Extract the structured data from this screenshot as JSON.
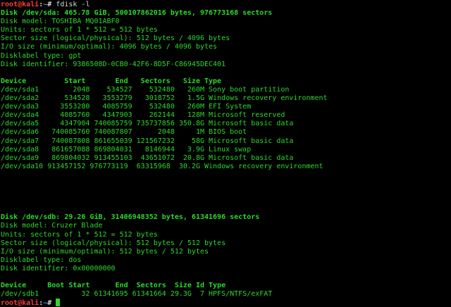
{
  "colors": {
    "text": "#2bd92b",
    "prompt_user": "#ff3b3b",
    "prompt_path": "#4a8cff",
    "background": "#000000"
  },
  "prompt": {
    "user": "root@kali",
    "sep": ":",
    "path": "~",
    "symbol": "# ",
    "command": "fdisk -l"
  },
  "disk1": {
    "header": "Disk /dev/sda: 465.78 GiB, 500107862016 bytes, 976773168 sectors",
    "info": [
      "Disk model: TOSHIBA MQ01ABF0",
      "Units: sectors of 1 * 512 = 512 bytes",
      "Sector size (logical/physical): 512 bytes / 4096 bytes",
      "I/O size (minimum/optimal): 4096 bytes / 4096 bytes",
      "Disklabel type: gpt",
      "Disk identifier: 9386508D-0CB0-42F6-8D5F-C86945DEC401"
    ],
    "table_header": "Device         Start       End   Sectors   Size Type",
    "rows": [
      "/dev/sda1        2048    534527    532480   260M Sony boot partition",
      "/dev/sda2      534528   3553279   3018752   1.5G Windows recovery environment",
      "/dev/sda3     3553280   4085759    532480   260M EFI System",
      "/dev/sda4     4085760   4347903    262144   128M Microsoft reserved",
      "/dev/sda5     4347904 740085759 735737856 350.8G Microsoft basic data",
      "/dev/sda6   740085760 740087807      2048     1M BIOS boot",
      "/dev/sda7   740087808 861655039 121567232    58G Microsoft basic data",
      "/dev/sda8   861657088 869804031   8146944   3.9G Linux swap",
      "/dev/sda9   869804032 913455103  43651072  20.8G Microsoft basic data",
      "/dev/sda10 913457152 976773119  63315968  30.2G Windows recovery environment"
    ]
  },
  "disk2": {
    "header": "Disk /dev/sdb: 29.26 GiB, 31406948352 bytes, 61341696 sectors",
    "info": [
      "Disk model: Cruzer Blade",
      "Units: sectors of 1 * 512 = 512 bytes",
      "Sector size (logical/physical): 512 bytes / 512 bytes",
      "I/O size (minimum/optimal): 512 bytes / 512 bytes",
      "Disklabel type: dos",
      "Disk identifier: 0x00000000"
    ],
    "table_header": "Device     Boot Start      End  Sectors  Size Id Type",
    "rows": [
      "/dev/sdb1          32 61341695 61341664 29.3G  7 HPFS/NTFS/exFAT"
    ]
  }
}
